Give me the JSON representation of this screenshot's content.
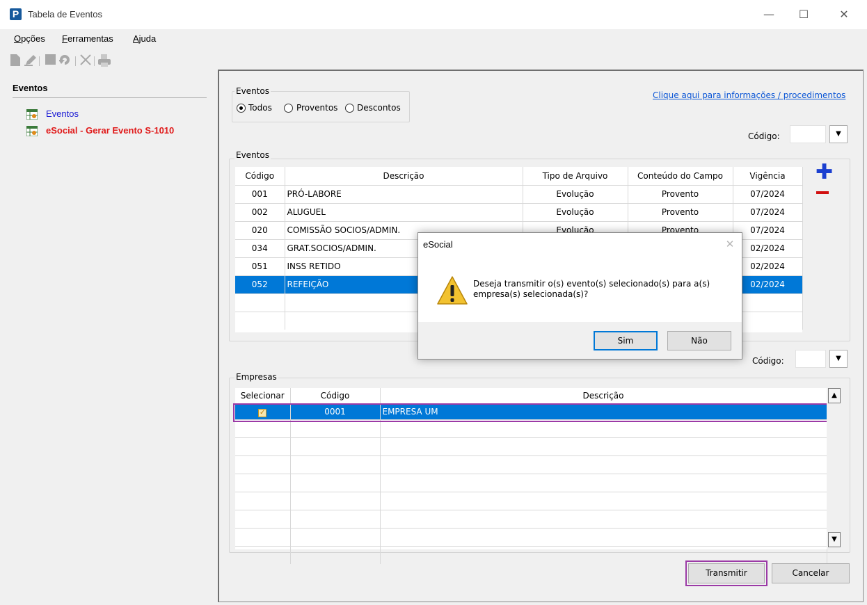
{
  "window": {
    "title": "Tabela de Eventos",
    "app_icon": "P",
    "controls": {
      "minimize": "—",
      "maximize": "☐",
      "close": "✕"
    }
  },
  "menu": {
    "opcoes": {
      "u": "O",
      "rest": "pções"
    },
    "ferramentas": {
      "u": "F",
      "rest": "erramentas"
    },
    "ajuda": {
      "u": "A",
      "rest": "juda"
    }
  },
  "toolbar": {
    "icons": [
      "new-doc-icon",
      "edit-icon",
      "save-icon",
      "undo-icon",
      "delete-icon",
      "print-icon"
    ]
  },
  "left_panel": {
    "title": "Eventos",
    "items": [
      {
        "label": "Eventos",
        "color": "#1a1ad4"
      },
      {
        "label": "eSocial - Gerar Evento S-1010",
        "color": "#e01a1a"
      }
    ]
  },
  "filter": {
    "legend": "Eventos",
    "options": [
      "Todos",
      "Proventos",
      "Descontos"
    ],
    "selected": "Todos"
  },
  "info_link": "Clique aqui para informações / procedimentos",
  "codigo_label": "Código:",
  "eventos": {
    "legend": "Eventos",
    "columns": [
      "Código",
      "Descrição",
      "Tipo de Arquivo",
      "Conteúdo do Campo",
      "Vigência"
    ],
    "rows": [
      {
        "codigo": "001",
        "descricao": "PRÓ-LABORE",
        "tipo": "Evolução",
        "conteudo": "Provento",
        "vigencia": "07/2024"
      },
      {
        "codigo": "002",
        "descricao": "ALUGUEL",
        "tipo": "Evolução",
        "conteudo": "Provento",
        "vigencia": "07/2024"
      },
      {
        "codigo": "020",
        "descricao": "COMISSÃO SOCIOS/ADMIN.",
        "tipo": "Evolução",
        "conteudo": "Provento",
        "vigencia": "07/2024"
      },
      {
        "codigo": "034",
        "descricao": "GRAT.SOCIOS/ADMIN.",
        "tipo": "",
        "conteudo": "",
        "vigencia": "02/2024"
      },
      {
        "codigo": "051",
        "descricao": "INSS RETIDO",
        "tipo": "",
        "conteudo": "",
        "vigencia": "02/2024"
      },
      {
        "codigo": "052",
        "descricao": "REFEIÇÃO",
        "tipo": "",
        "conteudo": "",
        "vigencia": "02/2024",
        "selected": true
      }
    ],
    "add_symbol": "✚",
    "remove_color": "#d11010"
  },
  "empresas": {
    "legend": "Empresas",
    "columns": [
      "Selecionar",
      "Código",
      "Descrição"
    ],
    "rows": [
      {
        "checked": true,
        "codigo": "0001",
        "descricao": "EMPRESA UM"
      }
    ]
  },
  "buttons": {
    "transmitir": "Transmitir",
    "cancelar": "Cancelar"
  },
  "dialog": {
    "title": "eSocial",
    "message_line1": "Deseja transmitir o(s) evento(s) selecionado(s) para a(s)",
    "message_line2": "empresa(s) selecionada(s)?",
    "icon": "warning-icon",
    "yes": "Sim",
    "no": "Não"
  },
  "colors": {
    "selection": "#0078d7",
    "highlight": "#9b3aa6",
    "link": "#0b56d6"
  }
}
